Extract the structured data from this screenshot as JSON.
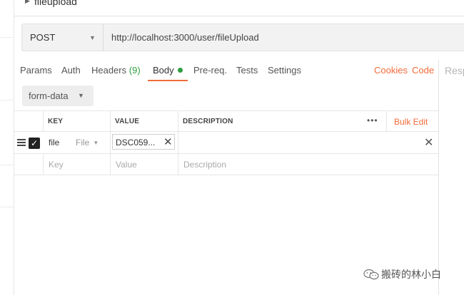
{
  "request": {
    "name": "fileupload",
    "method": "POST",
    "url": "http://localhost:3000/user/fileUpload"
  },
  "tabs": [
    {
      "label": "Params"
    },
    {
      "label": "Auth"
    },
    {
      "label": "Headers",
      "count": "(9)"
    },
    {
      "label": "Body",
      "active": true
    },
    {
      "label": "Pre-req."
    },
    {
      "label": "Tests"
    },
    {
      "label": "Settings"
    }
  ],
  "links": {
    "cookies": "Cookies",
    "code": "Code"
  },
  "response": {
    "label": "Resp"
  },
  "body": {
    "type": "form-data",
    "columns": {
      "key": "KEY",
      "value": "VALUE",
      "description": "DESCRIPTION",
      "bulk_edit": "Bulk Edit",
      "more": "•••"
    },
    "rows": [
      {
        "key": "file",
        "type": "File",
        "value": "DSC059...",
        "description": "",
        "checked": true
      }
    ],
    "placeholders": {
      "key": "Key",
      "value": "Value",
      "description": "Description"
    }
  },
  "watermark": {
    "text": "搬砖的林小白"
  },
  "colors": {
    "accent": "#f26b3a",
    "active_dot": "#2e9e3e",
    "count": "#2e9e3e"
  }
}
